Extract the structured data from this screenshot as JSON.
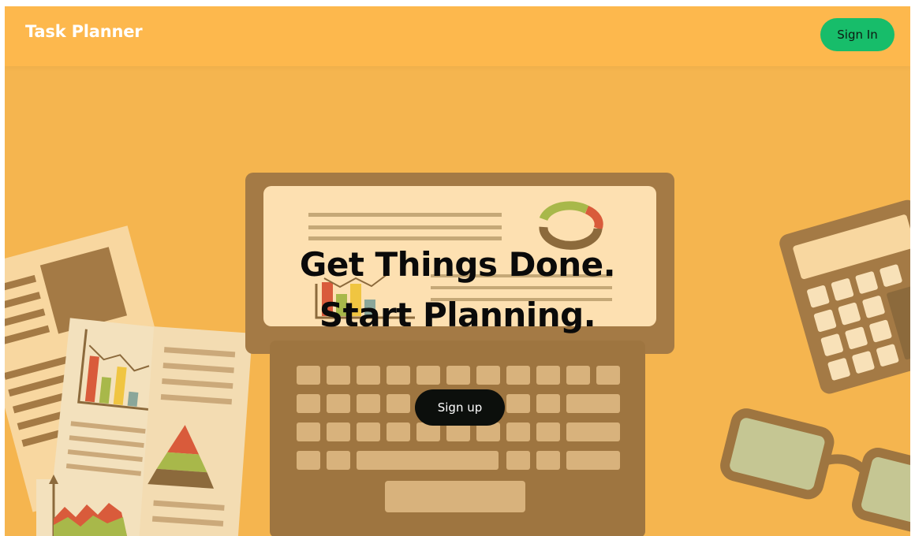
{
  "app": {
    "name": "Task Planner"
  },
  "header": {
    "signin_label": "Sign In"
  },
  "hero": {
    "line1": "Get Things Done.",
    "line2": "Start Planning.",
    "signup_label": "Sign up"
  },
  "icons": {
    "background": "desk-illustration-icon",
    "laptop": "laptop-icon",
    "documents": "documents-icon",
    "calculator": "calculator-icon",
    "glasses": "glasses-icon"
  },
  "colors": {
    "background": "#f5b54f",
    "navbar": "#fdb84d",
    "brand_text": "#ffffff",
    "signin_button": "#17bd6a",
    "signup_button": "#0c0f0c",
    "hero_text": "#0a0a0a"
  }
}
